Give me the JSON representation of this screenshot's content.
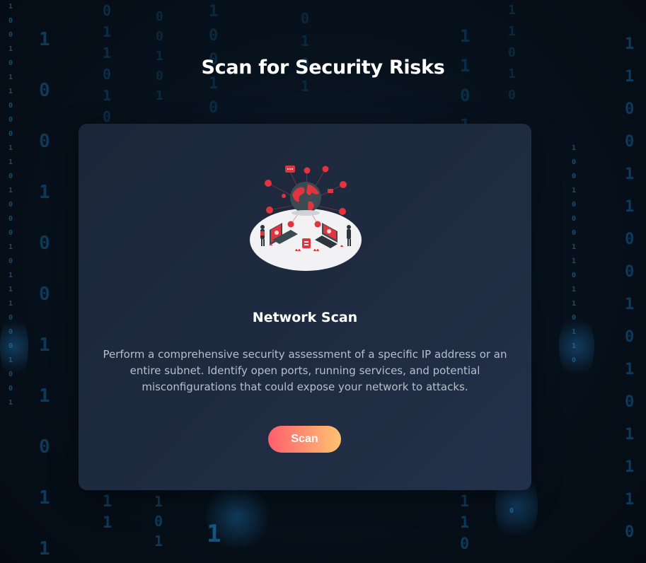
{
  "page": {
    "title": "Scan for Security Risks"
  },
  "card": {
    "illustration": "network-globe-illustration",
    "title": "Network Scan",
    "description": "Perform a comprehensive security assessment of a specific IP address or an entire subnet. Identify open ports, running services, and potential misconfigurations that could expose your network to attacks.",
    "button_label": "Scan"
  },
  "colors": {
    "background": "#07121d",
    "card": "#1f2b40",
    "button_gradient_start": "#ff5f6d",
    "button_gradient_end": "#ffc371",
    "matrix_digits": "#0d3a5a",
    "illustration_accent": "#e0353f"
  }
}
